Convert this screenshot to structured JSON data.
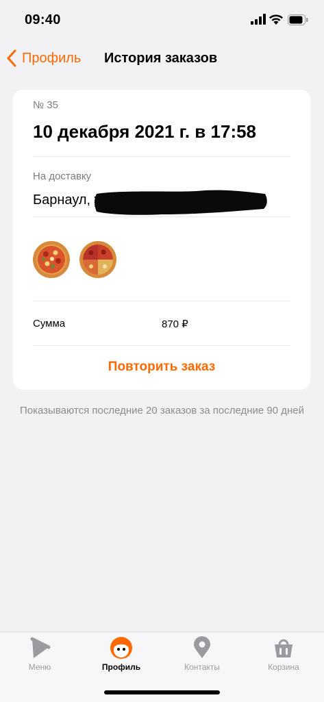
{
  "status_bar": {
    "time": "09:40",
    "icons": [
      "cellular-signal-icon",
      "wifi-icon",
      "battery-icon"
    ]
  },
  "nav": {
    "back_label": "Профиль",
    "title": "История заказов"
  },
  "order": {
    "number": "№ 35",
    "date": "10 декабря 2021 г. в 17:58",
    "delivery_label": "На доставку",
    "address": "Барнаул, ул",
    "items": [
      "pizza-icon",
      "pizza-icon"
    ],
    "sum_label": "Сумма",
    "sum_value": "870 ₽",
    "repeat_label": "Повторить заказ"
  },
  "footnote": "Показываются последние 20 заказов за последние 90 дней",
  "tabbar": {
    "tabs": [
      {
        "label": "Меню",
        "icon": "pizza-slice-icon",
        "active": false
      },
      {
        "label": "Профиль",
        "icon": "profile-face-icon",
        "active": true
      },
      {
        "label": "Контакты",
        "icon": "map-pin-icon",
        "active": false
      },
      {
        "label": "Корзина",
        "icon": "basket-icon",
        "active": false
      }
    ]
  },
  "colors": {
    "accent": "#ff6900",
    "background": "#f2f2f4",
    "card": "#ffffff",
    "muted_text": "#7a7a80",
    "inactive_tab": "#9a9aa0"
  }
}
